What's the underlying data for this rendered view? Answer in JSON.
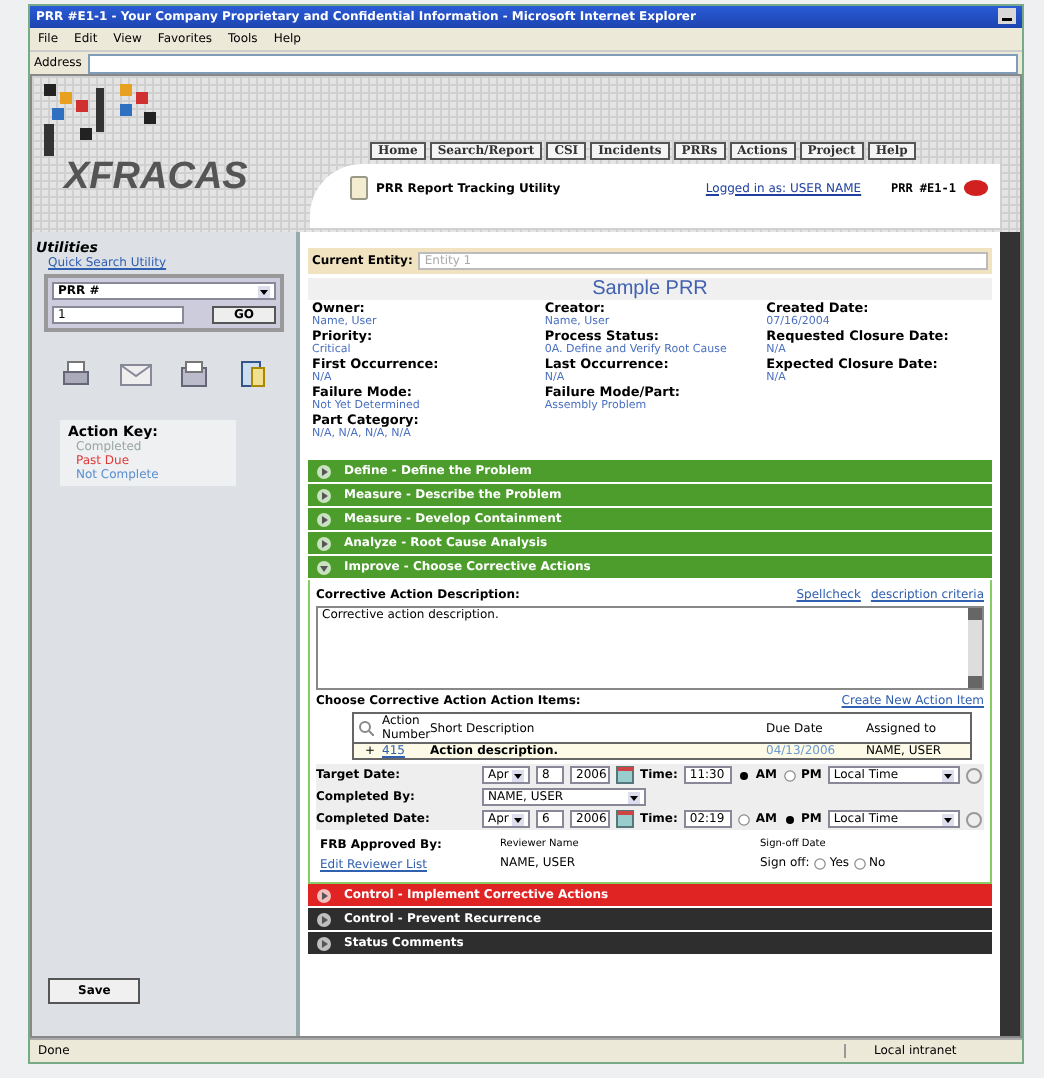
{
  "window": {
    "title": "PRR #E1-1 - Your Company Proprietary and Confidential Information - Microsoft Internet Explorer",
    "menu": [
      "File",
      "Edit",
      "View",
      "Favorites",
      "Tools",
      "Help"
    ],
    "address_label": "Address"
  },
  "header": {
    "logo": "XFRACAS",
    "tabs": [
      "Home",
      "Search/Report",
      "CSI",
      "Incidents",
      "PRRs",
      "Actions",
      "Project",
      "Help"
    ],
    "utility": "PRR Report Tracking Utility",
    "login": "Logged in as: USER NAME",
    "record_id": "PRR #E1-1"
  },
  "sidebar": {
    "heading": "Utilities",
    "quick_search": "Quick Search Utility",
    "search_type": "PRR #",
    "search_value": "1",
    "go": "GO",
    "action_key_title": "Action Key:",
    "legend": [
      {
        "label": "Completed",
        "color": "#9aa6a0"
      },
      {
        "label": "Past Due",
        "color": "#e03a3a"
      },
      {
        "label": "Not Complete",
        "color": "#5a8fd0"
      }
    ],
    "save": "Save"
  },
  "entity": {
    "label": "Current Entity:",
    "value": "Entity 1"
  },
  "title": "Sample PRR",
  "fields": [
    [
      {
        "label": "Owner:",
        "value": "Name, User"
      },
      {
        "label": "Priority:",
        "value": "Critical"
      },
      {
        "label": "First Occurrence:",
        "value": "N/A"
      },
      {
        "label": "Failure Mode:",
        "value": "Not Yet Determined"
      },
      {
        "label": "Part Category:",
        "value": "N/A, N/A, N/A, N/A"
      }
    ],
    [
      {
        "label": "Creator:",
        "value": "Name, User"
      },
      {
        "label": "Process Status:",
        "value": "0A. Define and Verify Root Cause"
      },
      {
        "label": "Last Occurrence:",
        "value": "N/A"
      },
      {
        "label": "Failure Mode/Part:",
        "value": "Assembly Problem"
      }
    ],
    [
      {
        "label": "Created Date:",
        "value": "07/16/2004"
      },
      {
        "label": "Requested Closure Date:",
        "value": "N/A"
      },
      {
        "label": "Expected Closure Date:",
        "value": "N/A"
      }
    ]
  ],
  "sections": [
    {
      "title": "Define - Define the Problem",
      "color": "#4c9d2c",
      "expanded": false
    },
    {
      "title": "Measure - Describe the Problem",
      "color": "#4c9d2c",
      "expanded": false
    },
    {
      "title": "Measure - Develop Containment",
      "color": "#4c9d2c",
      "expanded": false
    },
    {
      "title": "Analyze - Root Cause Analysis",
      "color": "#4c9d2c",
      "expanded": false
    },
    {
      "title": "Improve - Choose Corrective Actions",
      "color": "#4c9d2c",
      "expanded": true
    },
    {
      "title": "Control - Implement Corrective Actions",
      "color": "#e02424",
      "expanded": false
    },
    {
      "title": "Control - Prevent Recurrence",
      "color": "#2e2e2e",
      "expanded": false
    },
    {
      "title": "Status Comments",
      "color": "#2e2e2e",
      "expanded": false
    }
  ],
  "detail": {
    "description_label": "Corrective Action Description:",
    "spellcheck": "Spellcheck",
    "criteria": "description criteria",
    "description": "Corrective action description.",
    "items_label": "Choose Corrective Action Action Items:",
    "create_link": "Create New Action Item",
    "columns": [
      "Action Number",
      "Short Description",
      "Due Date",
      "Assigned to"
    ],
    "rows": [
      {
        "expander": "+",
        "number": "415",
        "description": "Action description.",
        "due": "04/13/2006",
        "assigned": "NAME, USER"
      }
    ],
    "dates": [
      {
        "kind": "date",
        "label": "Target Date:",
        "month": "Apr",
        "day": "8",
        "year": "2006",
        "time_label": "Time:",
        "time": "11:30",
        "am_pm": [
          {
            "label": "AM",
            "selected": true
          },
          {
            "label": "PM",
            "selected": false
          }
        ],
        "zone": "Local Time"
      },
      {
        "kind": "person",
        "label": "Completed By:",
        "value": "NAME, USER"
      },
      {
        "kind": "date",
        "label": "Completed Date:",
        "month": "Apr",
        "day": "6",
        "year": "2006",
        "time_label": "Time:",
        "time": "02:19",
        "am_pm": [
          {
            "label": "AM",
            "selected": false
          },
          {
            "label": "PM",
            "selected": true
          }
        ],
        "zone": "Local Time"
      }
    ],
    "approval": {
      "label": "FRB Approved By:",
      "link": "Edit Reviewer List",
      "name_heading": "Reviewer Name",
      "date_heading": "Sign-off Date",
      "name": "NAME, USER",
      "signoff_label": "Sign off:",
      "options": [
        {
          "label": "Yes",
          "selected": false
        },
        {
          "label": "No",
          "selected": false
        }
      ]
    }
  },
  "status_bar": {
    "text": "Done",
    "zone": "Local intranet"
  }
}
